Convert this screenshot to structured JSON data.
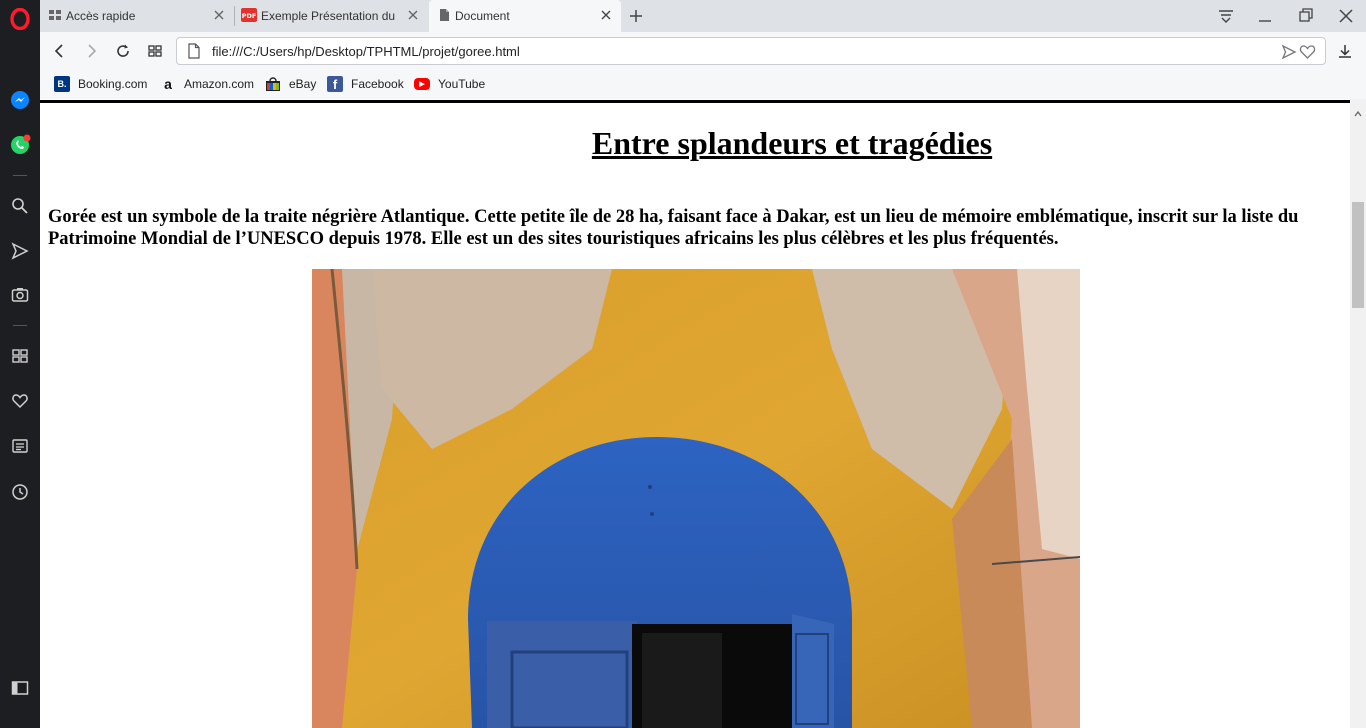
{
  "browser": {
    "tabs": [
      {
        "label": "Accès rapide",
        "icon": "speed-dial-icon"
      },
      {
        "label": "Exemple Présentation du p",
        "icon": "pdf-icon"
      },
      {
        "label": "Document",
        "icon": "document-icon"
      }
    ],
    "url": "file:///C:/Users/hp/Desktop/TPHTML/projet/goree.html",
    "bookmarks": [
      {
        "label": "Booking.com",
        "icon": "booking-icon",
        "glyph": "B."
      },
      {
        "label": "Amazon.com",
        "icon": "amazon-icon",
        "glyph": "a"
      },
      {
        "label": "eBay",
        "icon": "ebay-icon",
        "glyph": ""
      },
      {
        "label": "Facebook",
        "icon": "facebook-icon",
        "glyph": "f"
      },
      {
        "label": "YouTube",
        "icon": "youtube-icon",
        "glyph": "▶"
      }
    ],
    "sidebar_icons": [
      "opera-logo-icon",
      "messenger-icon",
      "whatsapp-icon",
      "search-icon",
      "send-icon",
      "camera-icon",
      "speed-dial-icon",
      "heart-icon",
      "news-icon",
      "history-icon",
      "sidebar-toggle-icon"
    ],
    "colors": {
      "sidebar": "#1c1e21",
      "opera_red": "#ff1b2d",
      "tabbar": "#dee1e5"
    }
  },
  "page": {
    "title": "Entre splandeurs et tragédies",
    "intro": "Gorée est un symbole de la traite négrière Atlantique. Cette petite île de 28 ha, faisant face à Dakar, est un lieu de mémoire emblématique, inscrit sur la liste du Patrimoine Mondial de l’UNESCO depuis 1978. Elle est un des sites touristiques africains les plus célèbres et les plus fréquentés."
  }
}
